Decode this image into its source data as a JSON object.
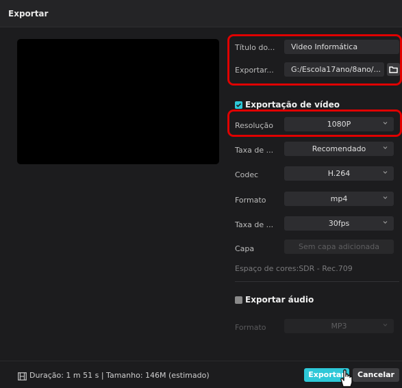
{
  "dialog": {
    "title": "Exportar"
  },
  "export_settings": {
    "title_label": "Título do...",
    "title_value": "Video Informática",
    "path_label": "Exportar...",
    "path_value": "G:/Escola17ano/8ano/..."
  },
  "video_section": {
    "label": "Exportação de vídeo",
    "checked": true,
    "rows": [
      {
        "label": "Resolução",
        "value": "1080P"
      },
      {
        "label": "Taxa de ...",
        "value": "Recomendado"
      },
      {
        "label": "Codec",
        "value": "H.264"
      },
      {
        "label": "Formato",
        "value": "mp4"
      },
      {
        "label": "Taxa de ...",
        "value": "30fps"
      }
    ],
    "cover_label": "Capa",
    "cover_value": "Sem capa adicionada",
    "color_space": "Espaço de cores:SDR - Rec.709"
  },
  "audio_section": {
    "label": "Exportar áudio",
    "checked": false,
    "format_label": "Formato",
    "format_value": "MP3"
  },
  "footer": {
    "info": "Duração: 1 m 51 s | Tamanho: 146M (estimado)",
    "export_label": "Exportar",
    "cancel_label": "Cancelar"
  },
  "colors": {
    "accent": "#2ec8d8",
    "highlight_box": "#e00000",
    "background": "#1c1c1e"
  }
}
